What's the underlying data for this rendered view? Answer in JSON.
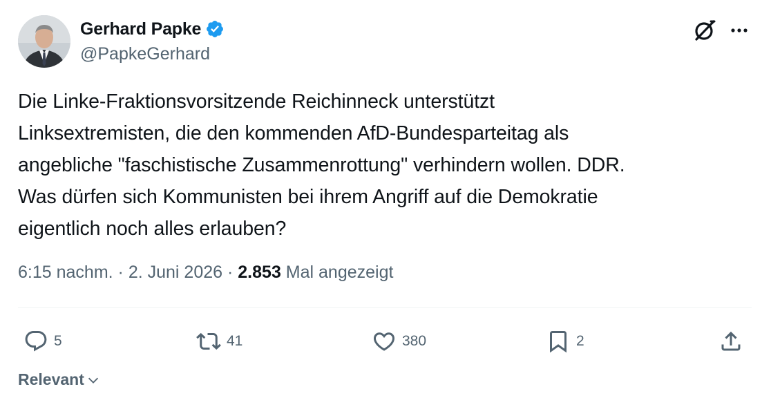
{
  "author": {
    "display_name": "Gerhard Papke",
    "handle": "@PapkeGerhard",
    "verified": true,
    "avatar_icon": "person-avatar-icon"
  },
  "tweet": {
    "text": "Die Linke-Fraktionsvorsitzende Reichinneck unterstützt\nLinksextremisten, die den kommenden AfD-Bundesparteitag als\nangebliche \"faschistische Zusammenrottung\" verhindern wollen. DDR.\nWas dürfen sich Kommunisten bei ihrem Angriff auf die Demokratie\neigentlich noch alles erlauben?",
    "time": "6:15 nachm.",
    "separator": "·",
    "date": "2. Juni 2026",
    "views_count": "2.853",
    "views_label": "Mal angezeigt"
  },
  "actions": {
    "reply_count": "5",
    "retweet_count": "41",
    "like_count": "380",
    "bookmark_count": "2"
  },
  "sort": {
    "label": "Relevant"
  },
  "icons": {
    "grok": "grok-icon",
    "more": "more-icon",
    "reply": "reply-icon",
    "retweet": "retweet-icon",
    "like": "heart-icon",
    "bookmark": "bookmark-icon",
    "share": "share-icon",
    "chevron": "chevron-down-icon"
  },
  "colors": {
    "text": "#0f1419",
    "secondary": "#536471",
    "verified": "#1d9bf0",
    "divider": "#eff3f4"
  }
}
